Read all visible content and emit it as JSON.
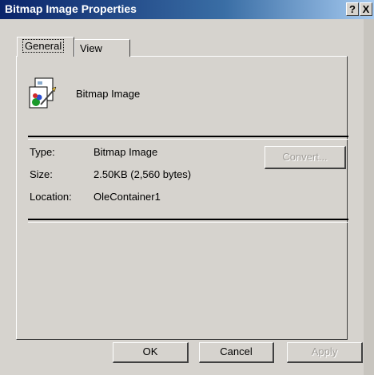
{
  "window": {
    "title": "Bitmap Image Properties",
    "help_label": "?",
    "close_label": "X"
  },
  "tabs": [
    {
      "label": "General",
      "selected": true
    },
    {
      "label": "View",
      "selected": false
    }
  ],
  "general": {
    "object_name": "Bitmap Image",
    "icon": "bitmap-image-icon",
    "fields": [
      {
        "label": "Type:",
        "value": "Bitmap Image"
      },
      {
        "label": "Size:",
        "value": "2.50KB (2,560 bytes)"
      },
      {
        "label": "Location:",
        "value": "OleContainer1"
      }
    ],
    "convert_label": "Convert..."
  },
  "buttons": {
    "ok": "OK",
    "cancel": "Cancel",
    "apply": "Apply"
  },
  "colors": {
    "titlebar_start": "#0a246a",
    "titlebar_end": "#a6caf0",
    "face": "#d6d3ce"
  }
}
